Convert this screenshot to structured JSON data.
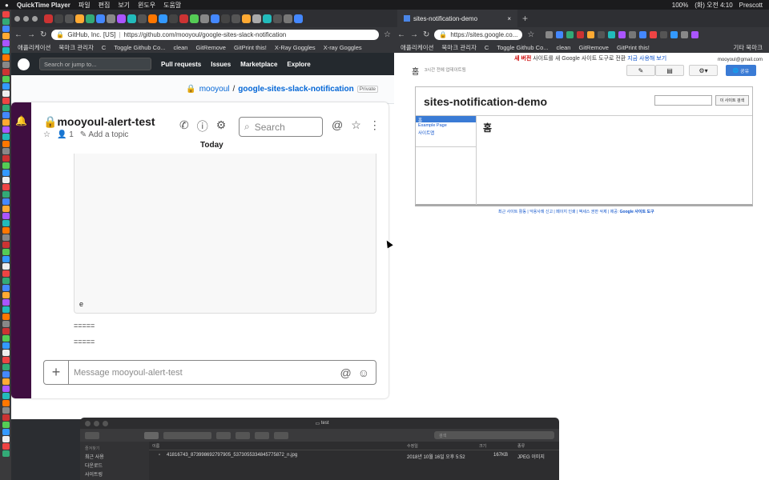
{
  "menubar": {
    "app": "QuickTime Player",
    "menus": [
      "파일",
      "편집",
      "보기",
      "윈도우",
      "도움말"
    ],
    "battery": "100%",
    "clock": "(화) 오전 4:10",
    "user": "Prescott"
  },
  "left_browser": {
    "url": "https://github.com/mooyoul/google-sites-slack-notification",
    "site_label": "GitHub, Inc. [US]",
    "bookmarks": [
      "애플리케이션",
      "북마크 관리자",
      "C",
      "Toggle Github Co...",
      "clean",
      "GitRemove",
      "GitPrint this!",
      "X-Ray Goggles",
      "X-ray Goggles"
    ],
    "github": {
      "search_placeholder": "Search or jump to...",
      "nav": [
        "Pull requests",
        "Issues",
        "Marketplace",
        "Explore"
      ],
      "repo_owner": "mooyoul",
      "repo_sep": "/",
      "repo_name": "google-sites-slack-notification",
      "visibility": "Private"
    }
  },
  "slack": {
    "channel": "mooyoul-alert-test",
    "members": "1",
    "topic": "Add a topic",
    "search_placeholder": "Search",
    "divider": "Today",
    "attachment_text": "e",
    "lines": [
      "=====",
      "====="
    ],
    "composer_placeholder": "Message mooyoul-alert-test"
  },
  "right_browser": {
    "tab_title": "sites-notification-demo",
    "url": "https://sites.google.co...",
    "bookmarks": [
      "애플리케이션",
      "북마크 관리자",
      "C",
      "Toggle Github Co...",
      "clean",
      "GitRemove",
      "GitPrint this!",
      "기타 북마크"
    ],
    "sites": {
      "notice_new": "새 버전",
      "notice_text": "사이트를 새 Google 사이트 도구로 전환",
      "notice_link": "지금 사용해 보기",
      "account": "mooyoul@gmail.com",
      "home_label": "홈",
      "updated": "3시간 전에 업데이트됨",
      "share_label": "공유",
      "site_title": "sites-notification-demo",
      "search_button": "이 사이트 검색",
      "nav": [
        "홈",
        "Example Page",
        "사이트맵"
      ],
      "content_heading": "홈",
      "footer": "최근 사이트 활동 | 악용사례 신고 | 페이지 인쇄 | 액세스 권한 삭제 | 제공:",
      "footer_link": "Google 사이트 도구"
    }
  },
  "finder": {
    "title": "test",
    "search_placeholder": "검색",
    "sidebar_heading": "즐겨찾기",
    "sidebar_items": [
      "최근 사용",
      "다운로드",
      "사이트링"
    ],
    "columns": [
      "이름",
      "수정일",
      "크기",
      "종류"
    ],
    "rows": [
      {
        "name": "41816743_873998692797905_5373055334845775872_n.jpg",
        "date": "2018년 10월 16일 오후 5:52",
        "size": "167KB",
        "kind": "JPEG 이미지"
      }
    ]
  },
  "colors": {
    "slack_sidebar": "#3f0e40",
    "github_header": "#24292e",
    "google_blue": "#3a7bd5"
  }
}
